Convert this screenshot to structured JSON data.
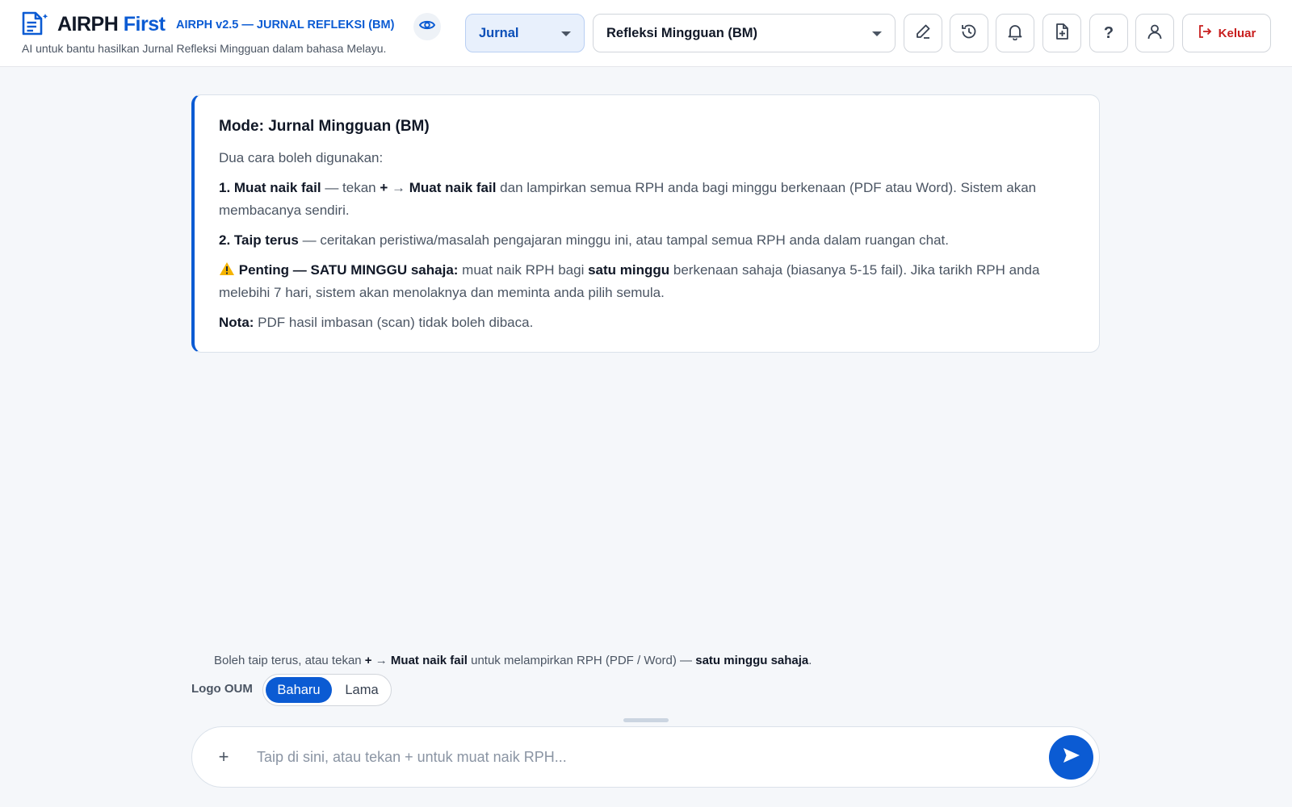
{
  "header": {
    "brand_main": "AIRPH",
    "brand_accent": "First",
    "version": "AIRPH v2.5 — JURNAL REFLEKSI (BM)",
    "subtitle": "AI untuk bantu hasilkan Jurnal Refleksi Mingguan dalam bahasa Melayu.",
    "mode_select": "Jurnal",
    "template_select": "Refleksi Mingguan (BM)",
    "help_label": "?",
    "logout_label": "Keluar",
    "icons": [
      "eye-icon",
      "pencil-icon",
      "history-icon",
      "bell-icon",
      "file-plus-icon",
      "help-icon",
      "user-icon",
      "logout-icon"
    ]
  },
  "card": {
    "title": "Mode: Jurnal Mingguan (BM)",
    "intro": "Dua cara boleh digunakan:",
    "item1_head": "1. Muat naik fail",
    "item1_a": " — tekan ",
    "item1_plus": "+",
    "item1_arrow": " → ",
    "item1_action": "Muat naik fail",
    "item1_b": " dan lampirkan semua RPH anda bagi minggu berkenaan (PDF atau Word). Sistem akan membacanya sendiri.",
    "item2_head": "2. Taip terus",
    "item2_text": " — ceritakan peristiwa/masalah pengajaran minggu ini, atau tampal semua RPH anda dalam ruangan chat.",
    "warn_head": "Penting — SATU MINGGU sahaja:",
    "warn_a": " muat naik RPH bagi ",
    "warn_bold": "satu minggu",
    "warn_b": " berkenaan sahaja (biasanya 5-15 fail). Jika tarikh RPH anda melebihi 7 hari, sistem akan menolaknya dan meminta anda pilih semula.",
    "note_head": "Nota:",
    "note_text": " PDF hasil imbasan (scan) tidak boleh dibaca."
  },
  "hint": {
    "a": "Boleh taip terus, atau tekan ",
    "plus": "+",
    "arrow": " → ",
    "action": "Muat naik fail",
    "b": " untuk melampirkan RPH (PDF / Word) — ",
    "bold": "satu minggu sahaja",
    "end": "."
  },
  "logo_toggle": {
    "label": "Logo OUM",
    "options": [
      "Baharu",
      "Lama"
    ],
    "selected": "Baharu"
  },
  "composer": {
    "plus_label": "+",
    "placeholder": "Taip di sini, atau tekan + untuk muat naik RPH...",
    "value": ""
  },
  "colors": {
    "accent": "#0b5bd3",
    "danger": "#c81e1e",
    "background": "#f5f7fa"
  }
}
